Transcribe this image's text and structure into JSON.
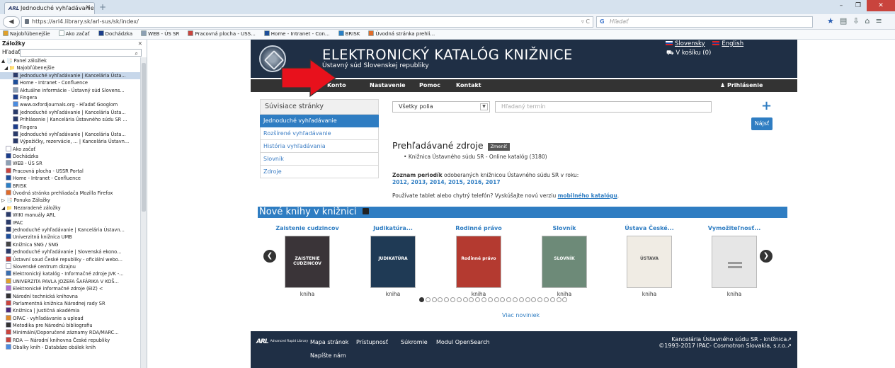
{
  "browser": {
    "tab_title": "Jednoduché vyhľadávanie |...",
    "url": "https://arl4.library.sk/arl-sus/sk/index/",
    "search_placeholder": "Hľadať",
    "search_engine_label": "G"
  },
  "bookmarks_bar": [
    "Najobľúbenejšie",
    "Ako začať",
    "Dochádzka",
    "WEB - ÚS SR",
    "Pracovná plocha - USS...",
    "Home - Intranet - Con...",
    "BRISK",
    "Úvodná stránka prehli..."
  ],
  "sidebar": {
    "title": "Záložky",
    "search_label": "Hľadať:",
    "items": [
      {
        "text": "▲ 📑 Panel záložiek",
        "indent": 2
      },
      {
        "text": "◢ 📁 Najobľúbenejšie",
        "indent": 6
      },
      {
        "text": "Jednoduché vyhľadávanie | Kancelária Ústa...",
        "indent": 18,
        "selected": true,
        "icon": "#2a3b6a"
      },
      {
        "text": "Home - Intranet - Confluence",
        "indent": 18,
        "icon": "#1e4f9a"
      },
      {
        "text": "Aktuálne informácie - Ústavný súd Slovens...",
        "indent": 18,
        "icon": "#8da0b3"
      },
      {
        "text": "Fingera",
        "indent": 18,
        "icon": "#1c3d8a"
      },
      {
        "text": "www.oxfordjournals.org - Hľadať Googlom",
        "indent": 18,
        "icon": "#4b8de0"
      },
      {
        "text": "Jednoduché vyhľadávanie | Kancelária Ústa...",
        "indent": 18,
        "icon": "#2a3b6a"
      },
      {
        "text": "Prihlásenie | Kancelária Ústavného súdu SR ...",
        "indent": 18,
        "icon": "#2a3b6a"
      },
      {
        "text": "Fingera",
        "indent": 18,
        "icon": "#1c3d8a"
      },
      {
        "text": "Jednoduché vyhľadávanie | Kancelária Ústa...",
        "indent": 18,
        "icon": "#2a3b6a"
      },
      {
        "text": "Výpožičky, rezervácie, ... | Kancelária Ústavn...",
        "indent": 18,
        "icon": "#2a3b6a"
      },
      {
        "text": "Ako začať",
        "indent": 8,
        "icon": "#ffffff"
      },
      {
        "text": "Dochádzka",
        "indent": 8,
        "icon": "#1c3d8a"
      },
      {
        "text": "WEB - ÚS SR",
        "indent": 8,
        "icon": "#8da0b3"
      },
      {
        "text": "Pracovná plocha - USSR Portal",
        "indent": 8,
        "icon": "#c9443d"
      },
      {
        "text": "Home - Intranet - Confluence",
        "indent": 8,
        "icon": "#1e4f9a"
      },
      {
        "text": "BRISK",
        "indent": 8,
        "icon": "#2b7fc4"
      },
      {
        "text": "Úvodná stránka prehliadača Mozilla Firefox",
        "indent": 8,
        "icon": "#e06c2a"
      },
      {
        "text": "▷ 📑 Ponuka Záložky",
        "indent": 2
      },
      {
        "text": "◢ 📁 Nezaradené záložky",
        "indent": 2
      },
      {
        "text": "WIKI manuály ARL",
        "indent": 8,
        "icon": "#2a3b6a"
      },
      {
        "text": "IPAC",
        "indent": 8,
        "icon": "#2a3b6a"
      },
      {
        "text": "Jednoduché vyhľadávanie | Kancelária Ústavn...",
        "indent": 8,
        "icon": "#2a3b6a"
      },
      {
        "text": "Univerzitná knižnica UMB",
        "indent": 8,
        "icon": "#1e4f9a"
      },
      {
        "text": "Knižnica SNG / SNG",
        "indent": 8,
        "icon": "#444444"
      },
      {
        "text": "Jednoduché vyhľadávanie | Slovenská ekono...",
        "indent": 8,
        "icon": "#2a3b6a"
      },
      {
        "text": "Ústavní soud České republiky - oficiální webo...",
        "indent": 8,
        "icon": "#c9443d"
      },
      {
        "text": "Slovenské centrum dizajnu",
        "indent": 8,
        "icon": "#ffffff"
      },
      {
        "text": "Elektronický katalóg - Informačné zdroje JVK -...",
        "indent": 8,
        "icon": "#3a6fb0"
      },
      {
        "text": "UNIVERZITA PAVLA JOZEFA ŠAFÁRIKA V KOŠ...",
        "indent": 8,
        "icon": "#e0a02a"
      },
      {
        "text": "Elektronické informačné zdroje (EIZ) <",
        "indent": 8,
        "icon": "#b06ad0"
      },
      {
        "text": "Národní technická knihovna",
        "indent": 8,
        "icon": "#333333"
      },
      {
        "text": "Parlamentná knižnica Národnej rady SR",
        "indent": 8,
        "icon": "#c9443d"
      },
      {
        "text": "Knižnica | Justičná akadémia",
        "indent": 8,
        "icon": "#4a2a7a"
      },
      {
        "text": "OPAC - vyhľadávanie a upload",
        "indent": 8,
        "icon": "#e08a2a"
      },
      {
        "text": "Metodika pre Národnú bibliografiu",
        "indent": 8,
        "icon": "#333333"
      },
      {
        "text": "Minimální/Doporučené záznamy RDA/MARC...",
        "indent": 8,
        "icon": "#c9443d"
      },
      {
        "text": "RDA — Národní knihovna České republiky",
        "indent": 8,
        "icon": "#c9443d"
      },
      {
        "text": "Obalky knih - Databáze obálek knih",
        "indent": 8,
        "icon": "#4b8de0"
      }
    ]
  },
  "site": {
    "title": "ELEKTRONICKÝ KATALÓG KNIŽNICE",
    "subtitle": "Ústavný súd Slovenskej republiky",
    "lang_sk": "Slovensky",
    "lang_en": "English",
    "cart": "V košíku (0)",
    "menu": [
      "Konto",
      "Nastavenie",
      "Pomoc",
      "Kontakt"
    ],
    "login": "Prihlásenie",
    "related_head": "Súvisiace stránky",
    "related_items": [
      "Jednoduché vyhľadávanie",
      "Rozšírené vyhľadávanie",
      "História vyhľadávania",
      "Slovník",
      "Zdroje"
    ],
    "field_select": "Všetky polia",
    "term_placeholder": "Hľadaný termín",
    "search_btn": "Nájsť",
    "sources_head": "Prehľadávané zdroje",
    "change_btn": "Zmeniť",
    "source_item": "Knižnica Ústavného súdu SR - Online katalóg (3180)",
    "periodiks_bold": "Zoznam periodík",
    "periodiks_rest": " odoberaných knižnicou Ústavného súdu SR v roku:",
    "years": "2012, 2013, 2014, 2015, 2016, 2017",
    "tablet_text": "Používate tablet alebo chytrý telefón? Vyskúšajte novú verziu ",
    "tablet_link": "mobilného katalógu",
    "tablet_end": ".",
    "newbooks_head": "Nové knihy v knižnici",
    "books": [
      {
        "title": "Zaistenie cudzincov",
        "type": "kniha",
        "cover_color": "#3a3438",
        "cover_text": "ZAISTENIE CUDZINCOV"
      },
      {
        "title": "Judikatúra...",
        "type": "kniha",
        "cover_color": "#1f3a55",
        "cover_text": "JUDIKATÚRA"
      },
      {
        "title": "Rodinné právo",
        "type": "kniha",
        "cover_color": "#b43a30",
        "cover_text": "Rodinné právo"
      },
      {
        "title": "Slovník",
        "type": "kniha",
        "cover_color": "#6d8a78",
        "cover_text": "SLOVNÍK"
      },
      {
        "title": "Ústava České...",
        "type": "kniha",
        "cover_color": "#f0ece4",
        "cover_text": "ÚSTAVA"
      },
      {
        "title": "Vymožiteľnosť...",
        "type": "kniha",
        "cover_color": "#e6e6e6",
        "cover_text": ""
      }
    ],
    "more_news": "Viac noviniek",
    "footer_logo": "ARL",
    "footer_logo_sub": "Advanced Rapid Library",
    "footer_links": [
      "Mapa stránok",
      "Prístupnosť",
      "Súkromie",
      "Modul OpenSearch",
      "Napíšte nám"
    ],
    "footer_right_1": "Kancelária Ústavného súdu SR - knižnica",
    "footer_right_2": "©1993-2017 IPAC- Cosmotron Slovakia, s.r.o."
  },
  "pagination": {
    "total": 24,
    "current": 1
  },
  "colors": {
    "accent": "#2f7dc2",
    "header": "#1f2f45",
    "menu": "#333333",
    "arrow": "#e8111c"
  }
}
